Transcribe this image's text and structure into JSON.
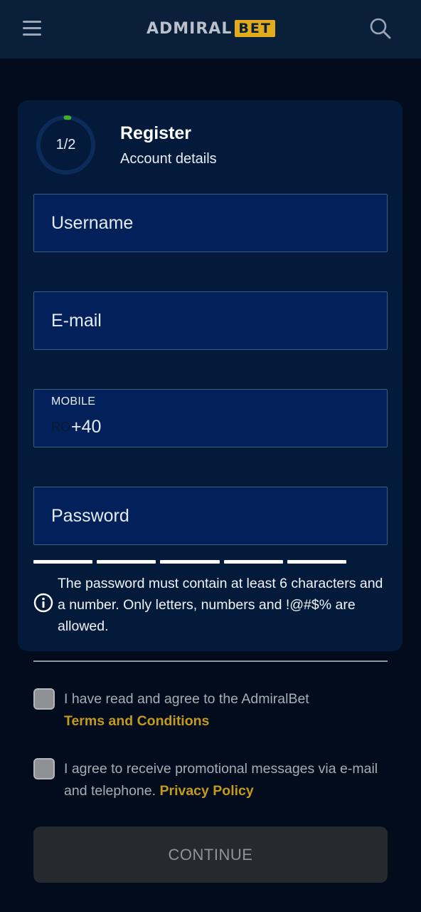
{
  "header": {
    "logo_main": "ADMIRAL",
    "logo_accent": "BET",
    "menu_icon": "hamburger-menu-icon",
    "search_icon": "search-icon"
  },
  "register": {
    "step": "1/2",
    "progress_fraction": 0.02,
    "title": "Register",
    "subtitle": "Account details"
  },
  "form": {
    "username_placeholder": "Username",
    "email_placeholder": "E-mail",
    "mobile_label": "MOBILE",
    "country_code": "RO",
    "dial_prefix": "+40",
    "password_placeholder": "Password",
    "password_hint": "The password must contain at least 6 characters and a number. Only letters, numbers and !@#$% are allowed.",
    "info_icon": "info-icon"
  },
  "consents": {
    "terms_text": "I have read and agree to the AdmiralBet",
    "terms_link": "Terms and Conditions",
    "promo_text": "I agree to receive promotional messages via e-mail and telephone.",
    "privacy_link": "Privacy Policy"
  },
  "actions": {
    "continue_label": "CONTINUE"
  },
  "colors": {
    "background": "#020c1c",
    "header": "#0a1f3a",
    "card": "#031a3b",
    "input": "#02215a",
    "accent_gold": "#c39a1c",
    "progress_green": "#3fae2a"
  }
}
